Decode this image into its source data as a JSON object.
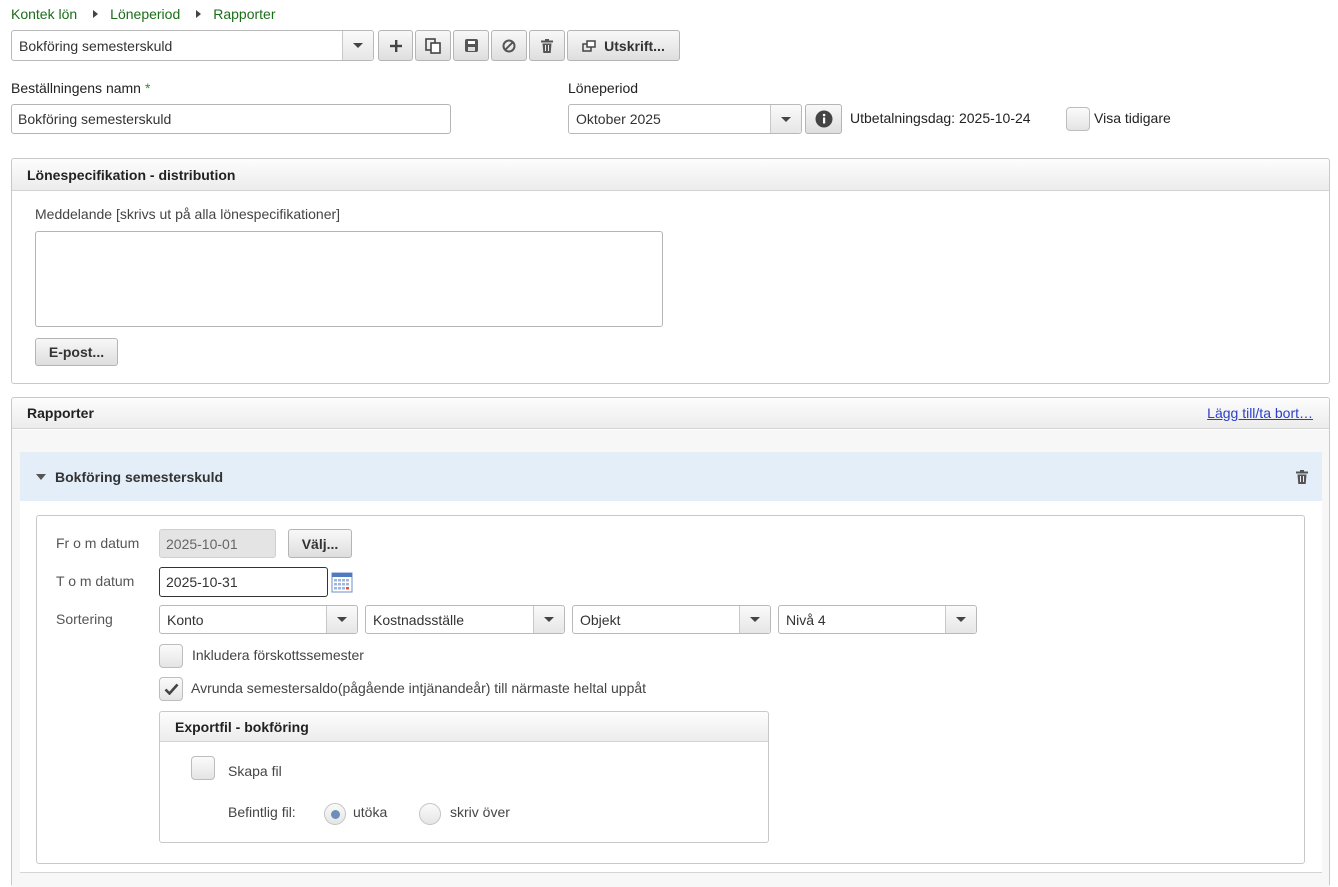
{
  "breadcrumb": [
    "Kontek lön",
    "Löneperiod",
    "Rapporter"
  ],
  "report_select": {
    "value": "Bokföring semesterskuld"
  },
  "toolbar": {
    "print_label": "Utskrift..."
  },
  "order_name": {
    "label": "Beställningens namn",
    "required_mark": "*",
    "value": "Bokföring semesterskuld"
  },
  "pay_period": {
    "label": "Löneperiod",
    "value": "Oktober 2025",
    "payment_day": "Utbetalningsdag: 2025-10-24",
    "show_earlier_label": "Visa tidigare"
  },
  "distribution": {
    "title": "Lönespecifikation - distribution",
    "message_label": "Meddelande [skrivs ut på alla lönespecifikationer]",
    "message_value": "",
    "email_button": "E-post..."
  },
  "reports": {
    "title": "Rapporter",
    "add_remove_link": "Lägg till/ta bort…",
    "item": {
      "title": "Bokföring semesterskuld",
      "from_date_label": "Fr o m datum",
      "from_date_value": "2025-10-01",
      "choose_button": "Välj...",
      "to_date_label": "T o m datum",
      "to_date_value": "2025-10-31",
      "sort_label": "Sortering",
      "sort_options": [
        "Konto",
        "Kostnadsställe",
        "Objekt",
        "Nivå 4"
      ],
      "include_advance_label": "Inkludera förskottssemester",
      "include_advance_checked": false,
      "round_label": "Avrunda semestersaldo(pågående intjänandeår) till närmaste heltal uppåt",
      "round_checked": true,
      "export": {
        "title": "Exportfil - bokföring",
        "create_file_label": "Skapa fil",
        "create_file_checked": false,
        "existing_file_label": "Befintlig fil:",
        "option_extend": "utöka",
        "option_overwrite": "skriv över",
        "selected": "utöka"
      }
    }
  },
  "colors": {
    "breadcrumb": "#1a6e1a",
    "link": "#2a3fc9",
    "required": "#2f8f2f",
    "section_bg": "#e3eef8"
  }
}
